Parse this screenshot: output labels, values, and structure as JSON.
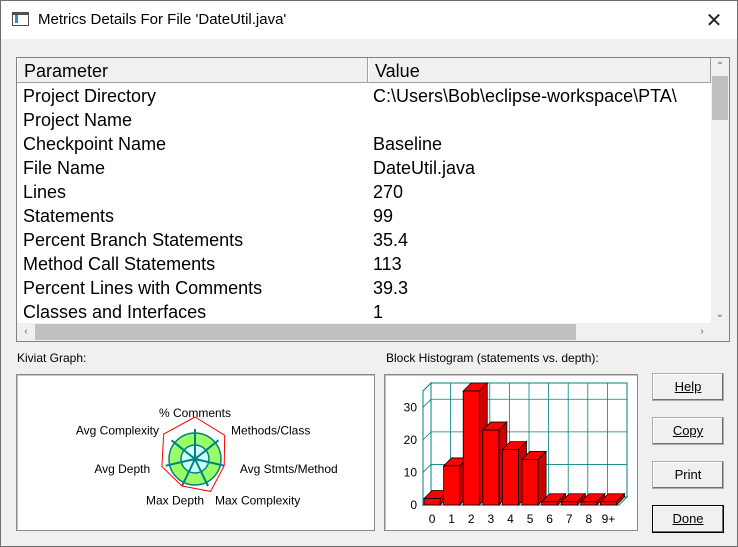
{
  "window": {
    "title": "Metrics Details For File 'DateUtil.java'",
    "close_glyph": "✕"
  },
  "table": {
    "headers": {
      "parameter": "Parameter",
      "value": "Value"
    },
    "rows": [
      {
        "parameter": "Project Directory",
        "value": "C:\\Users\\Bob\\eclipse-workspace\\PTA\\"
      },
      {
        "parameter": "Project Name",
        "value": ""
      },
      {
        "parameter": "Checkpoint Name",
        "value": "Baseline"
      },
      {
        "parameter": "File Name",
        "value": "DateUtil.java"
      },
      {
        "parameter": "Lines",
        "value": "270"
      },
      {
        "parameter": "Statements",
        "value": "99"
      },
      {
        "parameter": "Percent Branch Statements",
        "value": "35.4"
      },
      {
        "parameter": "Method Call Statements",
        "value": "113"
      },
      {
        "parameter": "Percent Lines with Comments",
        "value": "39.3"
      },
      {
        "parameter": "Classes and Interfaces",
        "value": "1"
      }
    ],
    "scroll_glyphs": {
      "up": "⌃",
      "down": "⌄",
      "left": "‹",
      "right": "›"
    }
  },
  "kiviat": {
    "label": "Kiviat Graph:",
    "axes": [
      "% Comments",
      "Methods/Class",
      "Avg Stmts/Method",
      "Max Complexity",
      "Max Depth",
      "Avg Depth",
      "Avg Complexity"
    ]
  },
  "histogram": {
    "label": "Block Histogram (statements vs. depth):"
  },
  "chart_data": {
    "type": "bar",
    "title": "Block Histogram (statements vs. depth):",
    "categories": [
      "0",
      "1",
      "2",
      "3",
      "4",
      "5",
      "6",
      "7",
      "8",
      "9+"
    ],
    "values": [
      2,
      12,
      35,
      23,
      17,
      14,
      1,
      1,
      1,
      1
    ],
    "ylim": [
      0,
      35
    ],
    "yticks": [
      "0",
      "10",
      "20",
      "30"
    ],
    "grid": true,
    "bar_color": "#ff0000"
  },
  "buttons": {
    "help": "Help",
    "copy": "Copy",
    "print": "Print",
    "done": "Done"
  },
  "colors": {
    "kiviat_fill": "#99ff66",
    "kiviat_inner": "#ccffff",
    "kiviat_axis": "#008080",
    "kiviat_poly": "#ff0000",
    "hist_grid": "#008080",
    "hist_bar": "#ff0000"
  }
}
